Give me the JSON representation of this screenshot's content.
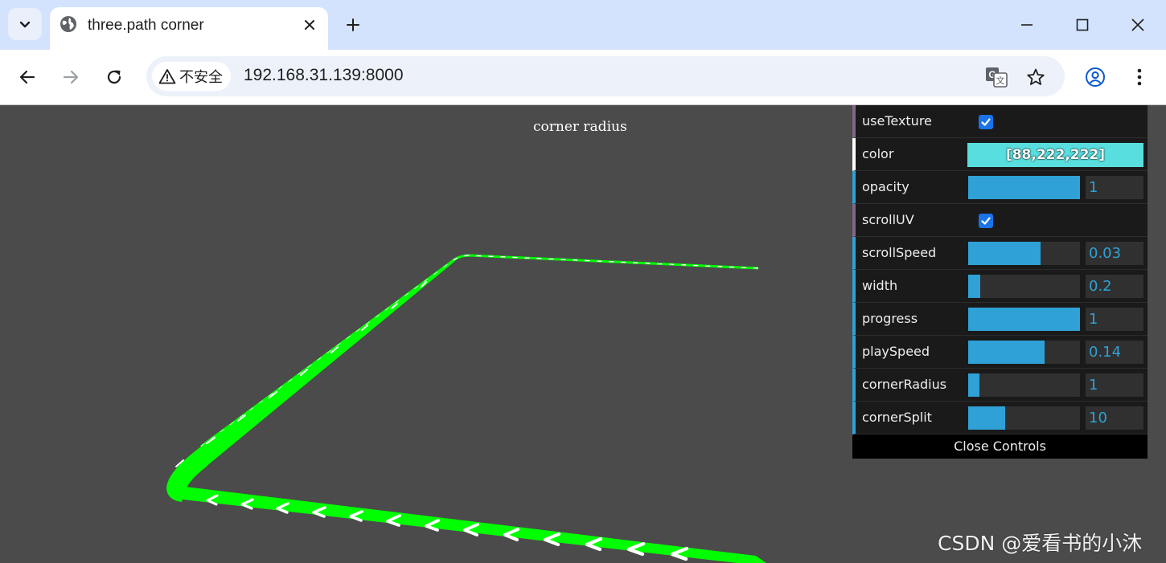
{
  "browser": {
    "tab_title": "three.path corner",
    "new_tab_symbol": "+",
    "security_label": "不安全",
    "url": "192.168.31.139:8000",
    "icons": {
      "tab_menu": "chevron-down-icon",
      "tab_favicon": "globe-icon",
      "tab_close": "close-icon",
      "minimize": "minimize-icon",
      "maximize": "maximize-icon",
      "close_window": "close-icon",
      "back": "arrow-left-icon",
      "forward": "arrow-right-icon",
      "reload": "reload-icon",
      "warning": "warning-icon",
      "translate": "translate-icon",
      "bookmark": "star-icon",
      "profile": "account-icon",
      "menu": "more-vert-icon"
    }
  },
  "scene": {
    "title": "corner radius",
    "background_color": "#4b4b4b",
    "path_color": "#00ff00",
    "arrow_color": "#ffffff"
  },
  "controls": {
    "useTexture": {
      "label": "useTexture",
      "checked": true
    },
    "color": {
      "label": "color",
      "value": "[88,222,222]",
      "hex": "#58dede"
    },
    "sliders": [
      {
        "key": "opacity",
        "label": "opacity",
        "value": "1",
        "fraction": 1.0
      },
      {
        "key": "scrollSpeed",
        "label": "scrollSpeed",
        "value": "0.03",
        "fraction": 0.65
      },
      {
        "key": "width",
        "label": "width",
        "value": "0.2",
        "fraction": 0.11
      },
      {
        "key": "progress",
        "label": "progress",
        "value": "1",
        "fraction": 1.0
      },
      {
        "key": "playSpeed",
        "label": "playSpeed",
        "value": "0.14",
        "fraction": 0.68
      },
      {
        "key": "cornerRadius",
        "label": "cornerRadius",
        "value": "1",
        "fraction": 0.1
      },
      {
        "key": "cornerSplit",
        "label": "cornerSplit",
        "value": "10",
        "fraction": 0.33
      }
    ],
    "scrollUV": {
      "label": "scrollUV",
      "checked": true
    },
    "close_label": "Close Controls"
  },
  "watermark": "CSDN @爱看书的小沐"
}
